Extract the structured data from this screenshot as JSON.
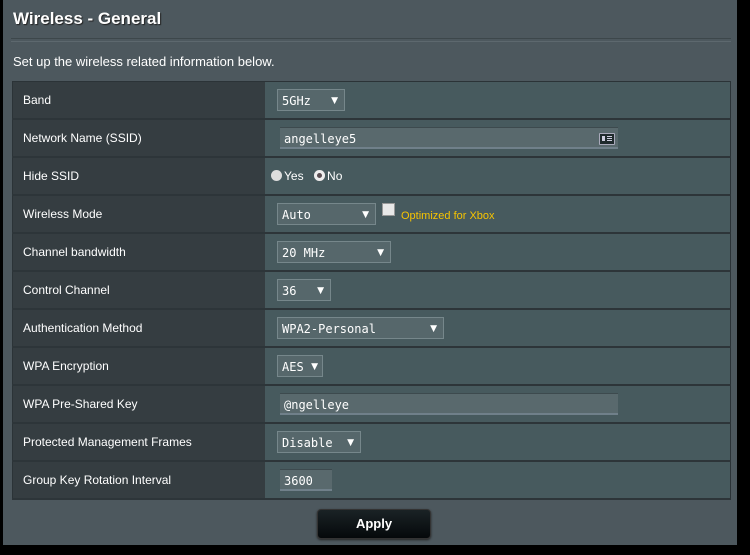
{
  "header": {
    "title": "Wireless - General",
    "subtitle": "Set up the wireless related information below."
  },
  "fields": {
    "band": {
      "label": "Band",
      "value": "5GHz"
    },
    "ssid": {
      "label": "Network Name (SSID)",
      "value": "angelleye5",
      "icon": "id-card-icon"
    },
    "hide_ssid": {
      "label": "Hide SSID",
      "options": [
        "Yes",
        "No"
      ],
      "selected": "No"
    },
    "wireless_mode": {
      "label": "Wireless Mode",
      "value": "Auto",
      "checkbox_label": "Optimized for Xbox",
      "checkbox_checked": false
    },
    "channel_bandwidth": {
      "label": "Channel bandwidth",
      "value": "20 MHz"
    },
    "control_channel": {
      "label": "Control Channel",
      "value": "36"
    },
    "auth_method": {
      "label": "Authentication Method",
      "value": "WPA2-Personal"
    },
    "wpa_encryption": {
      "label": "WPA Encryption",
      "value": "AES"
    },
    "psk": {
      "label": "WPA Pre-Shared Key",
      "value": "@ngelleye"
    },
    "pmf": {
      "label": "Protected Management Frames",
      "value": "Disable"
    },
    "gk_interval": {
      "label": "Group Key Rotation Interval",
      "value": "3600"
    }
  },
  "actions": {
    "apply_label": "Apply"
  },
  "colors": {
    "accent_xbox": "#f7c400",
    "panel_bg": "#4d585e",
    "label_bg": "#353d41",
    "value_bg": "#475a5e"
  }
}
